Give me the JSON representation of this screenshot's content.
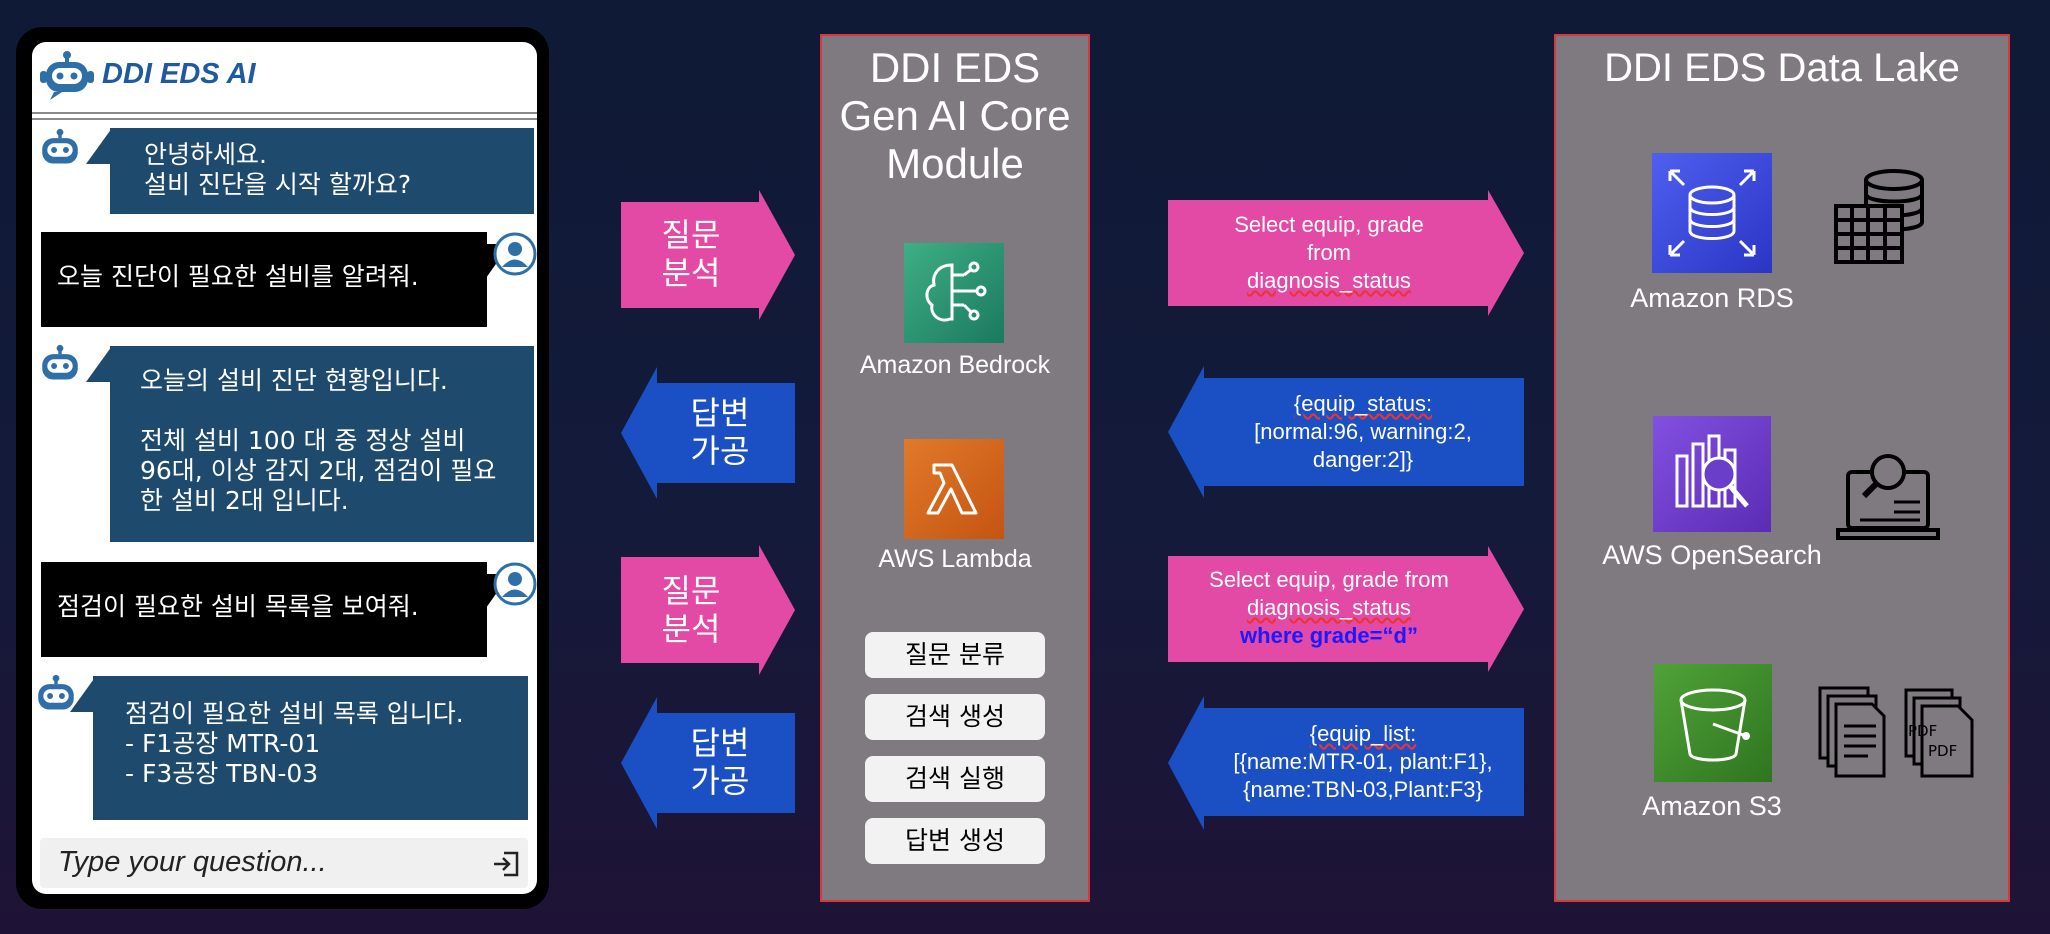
{
  "chat": {
    "title": "DDI EDS AI",
    "messages": [
      {
        "role": "bot",
        "lines": [
          "안녕하세요.",
          "설비 진단을 시작 할까요?"
        ]
      },
      {
        "role": "user",
        "lines": [
          "오늘 진단이 필요한 설비를 알려줘."
        ]
      },
      {
        "role": "bot",
        "lines": [
          "오늘의 설비 진단 현황입니다.",
          "",
          "전체 설비 100 대 중 정상 설비",
          "96대, 이상 감지 2대, 점검이 필요",
          "한 설비 2대 입니다."
        ]
      },
      {
        "role": "user",
        "lines": [
          "점검이 필요한 설비 목록을 보여줘."
        ]
      },
      {
        "role": "bot",
        "lines": [
          "점검이 필요한 설비 목록 입니다.",
          "- F1공장 MTR-01",
          "- F3공장 TBN-03"
        ]
      }
    ],
    "input_placeholder": "Type your question..."
  },
  "left_arrows": [
    {
      "lines": [
        "질문",
        "분석"
      ],
      "color": "#e24aa6",
      "direction": "right"
    },
    {
      "lines": [
        "답변",
        "가공"
      ],
      "color": "#1b4fc4",
      "direction": "left"
    },
    {
      "lines": [
        "질문",
        "분석"
      ],
      "color": "#e24aa6",
      "direction": "right"
    },
    {
      "lines": [
        "답변",
        "가공"
      ],
      "color": "#1b4fc4",
      "direction": "left"
    }
  ],
  "core_panel": {
    "title_lines": [
      "DDI EDS",
      "Gen AI Core",
      "Module"
    ],
    "services": [
      {
        "label": "Amazon Bedrock",
        "icon": "bedrock-icon",
        "color": "#1f8f6e"
      },
      {
        "label": "AWS Lambda",
        "icon": "lambda-icon",
        "color": "#d4641c"
      }
    ],
    "steps": [
      "질문 분류",
      "검색 생성",
      "검색 실행",
      "답변 생성"
    ]
  },
  "right_arrows": [
    {
      "direction": "right",
      "color": "#e24aa6",
      "lines": [
        {
          "text": "Select equip, grade"
        },
        {
          "text": "from"
        },
        {
          "text": "diagnosis_status",
          "squiggle": true
        }
      ]
    },
    {
      "direction": "left",
      "color": "#1b4fc4",
      "lines": [
        {
          "text": "{equip_status:",
          "squiggle": true
        },
        {
          "text": "[normal:96, warning:2,"
        },
        {
          "text": "danger:2]}"
        }
      ]
    },
    {
      "direction": "right",
      "color": "#e24aa6",
      "lines": [
        {
          "text": "Select equip, grade from"
        },
        {
          "text": "diagnosis_status",
          "squiggle": true
        },
        {
          "text": "where grade=“d”",
          "highlight": "#1a1aff"
        }
      ]
    },
    {
      "direction": "left",
      "color": "#1b4fc4",
      "lines": [
        {
          "text": "{equip_list:",
          "squiggle": true
        },
        {
          "text": "[{name:MTR-01, plant:F1},"
        },
        {
          "text": "{name:TBN-03,Plant:F3}"
        }
      ]
    }
  ],
  "data_lake": {
    "title": "DDI EDS Data Lake",
    "services": [
      {
        "label": "Amazon RDS",
        "icon": "rds-icon",
        "color": "#3a4bd6",
        "side_icon": "database-table-icon"
      },
      {
        "label": "AWS OpenSearch",
        "icon": "opensearch-icon",
        "color": "#6a3ec9",
        "side_icon": "laptop-search-icon"
      },
      {
        "label": "Amazon S3",
        "icon": "s3-icon",
        "color": "#3f8b2a",
        "side_icon": "documents-icon",
        "side_icon2": "pdf-files-icon",
        "pdf_text": "PDF"
      }
    ]
  }
}
